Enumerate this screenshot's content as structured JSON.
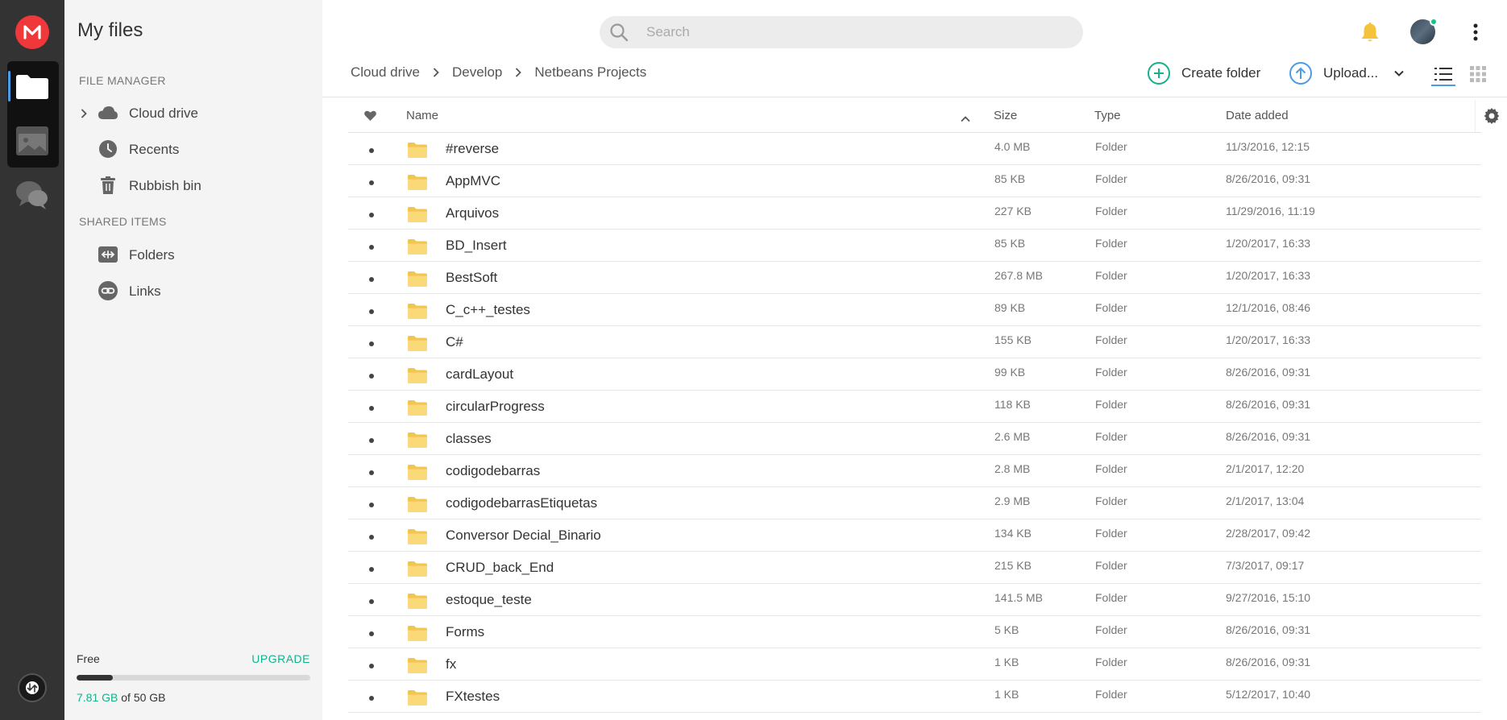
{
  "rail": {
    "logo_letter": "M",
    "active_color": "#4a9be8",
    "accent": "#f0373a"
  },
  "sidebar": {
    "title": "My files",
    "file_manager_label": "FILE MANAGER",
    "shared_items_label": "SHARED ITEMS",
    "items": [
      {
        "label": "Cloud drive",
        "icon": "cloud-icon"
      },
      {
        "label": "Recents",
        "icon": "clock-icon"
      },
      {
        "label": "Rubbish bin",
        "icon": "trash-icon"
      }
    ],
    "shared": [
      {
        "label": "Folders",
        "icon": "shared-folder-icon"
      },
      {
        "label": "Links",
        "icon": "link-icon"
      }
    ],
    "storage": {
      "plan": "Free",
      "upgrade": "UPGRADE",
      "used": "7.81 GB",
      "total_text": "of 50 GB",
      "used_fraction": 0.156
    }
  },
  "search": {
    "placeholder": "Search"
  },
  "breadcrumb": [
    "Cloud drive",
    "Develop",
    "Netbeans Projects"
  ],
  "actions": {
    "create_folder": "Create folder",
    "upload": "Upload..."
  },
  "table": {
    "columns": {
      "name": "Name",
      "size": "Size",
      "type": "Type",
      "date": "Date added"
    },
    "rows": [
      {
        "name": "#reverse",
        "size": "4.0 MB",
        "type": "Folder",
        "date": "11/3/2016, 12:15"
      },
      {
        "name": "AppMVC",
        "size": "85 KB",
        "type": "Folder",
        "date": "8/26/2016, 09:31"
      },
      {
        "name": "Arquivos",
        "size": "227 KB",
        "type": "Folder",
        "date": "11/29/2016, 11:19"
      },
      {
        "name": "BD_Insert",
        "size": "85 KB",
        "type": "Folder",
        "date": "1/20/2017, 16:33"
      },
      {
        "name": "BestSoft",
        "size": "267.8 MB",
        "type": "Folder",
        "date": "1/20/2017, 16:33"
      },
      {
        "name": "C_c++_testes",
        "size": "89 KB",
        "type": "Folder",
        "date": "12/1/2016, 08:46"
      },
      {
        "name": "C#",
        "size": "155 KB",
        "type": "Folder",
        "date": "1/20/2017, 16:33"
      },
      {
        "name": "cardLayout",
        "size": "99 KB",
        "type": "Folder",
        "date": "8/26/2016, 09:31"
      },
      {
        "name": "circularProgress",
        "size": "118 KB",
        "type": "Folder",
        "date": "8/26/2016, 09:31"
      },
      {
        "name": "classes",
        "size": "2.6 MB",
        "type": "Folder",
        "date": "8/26/2016, 09:31"
      },
      {
        "name": "codigodebarras",
        "size": "2.8 MB",
        "type": "Folder",
        "date": "2/1/2017, 12:20"
      },
      {
        "name": "codigodebarrasEtiquetas",
        "size": "2.9 MB",
        "type": "Folder",
        "date": "2/1/2017, 13:04"
      },
      {
        "name": "Conversor Decial_Binario",
        "size": "134 KB",
        "type": "Folder",
        "date": "2/28/2017, 09:42"
      },
      {
        "name": "CRUD_back_End",
        "size": "215 KB",
        "type": "Folder",
        "date": "7/3/2017, 09:17"
      },
      {
        "name": "estoque_teste",
        "size": "141.5 MB",
        "type": "Folder",
        "date": "9/27/2016, 15:10"
      },
      {
        "name": "Forms",
        "size": "5 KB",
        "type": "Folder",
        "date": "8/26/2016, 09:31"
      },
      {
        "name": "fx",
        "size": "1 KB",
        "type": "Folder",
        "date": "8/26/2016, 09:31"
      },
      {
        "name": "FXtestes",
        "size": "1 KB",
        "type": "Folder",
        "date": "5/12/2017, 10:40"
      }
    ]
  },
  "colors": {
    "brand_red": "#f0373a",
    "green": "#13b28d",
    "blue": "#4a9be8",
    "bell": "#f5c33b",
    "folder": "#f7d36a"
  }
}
